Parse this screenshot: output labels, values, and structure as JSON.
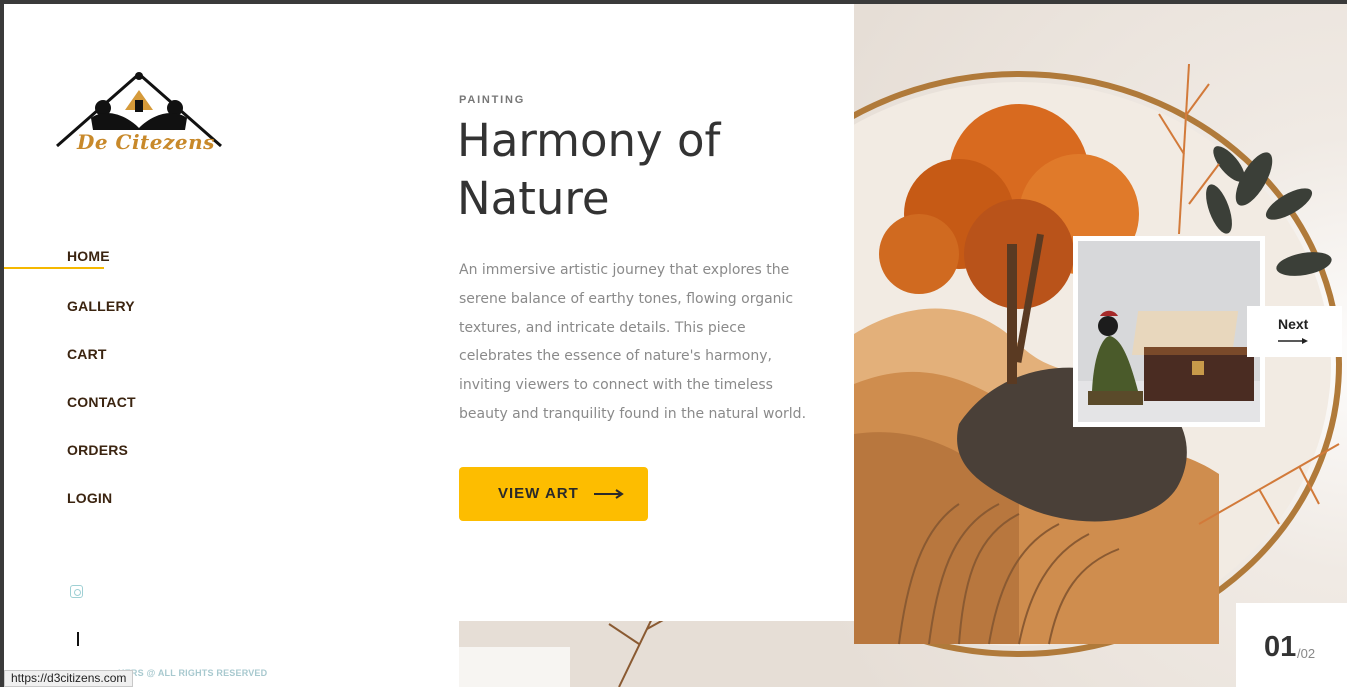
{
  "brand": {
    "name": "De Citezens"
  },
  "nav": {
    "items": [
      {
        "label": "HOME",
        "active": true
      },
      {
        "label": "GALLERY"
      },
      {
        "label": "CART"
      },
      {
        "label": "CONTACT"
      },
      {
        "label": "ORDERS"
      },
      {
        "label": "LOGIN"
      }
    ]
  },
  "social": {
    "icon": "instagram-icon"
  },
  "footer": {
    "copyright_visible": "KERS @ ALL RIGHTS RESERVED"
  },
  "status_bar": {
    "url": "https://d3citizens.com"
  },
  "hero": {
    "category": "PAINTING",
    "title_line1": "Harmony of",
    "title_line2": "Nature",
    "description": "An immersive artistic journey that explores the serene balance of earthy tones, flowing organic textures, and intricate details. This piece celebrates the essence of nature's harmony, inviting viewers to connect with the timeless beauty and tranquility found in the natural world.",
    "cta_label": "VIEW ART"
  },
  "slider": {
    "next_label": "Next",
    "current": "01",
    "total": "/02"
  },
  "colors": {
    "accent": "#fdbd00",
    "nav_text": "#3b2410",
    "brand_gold": "#c8892a"
  }
}
